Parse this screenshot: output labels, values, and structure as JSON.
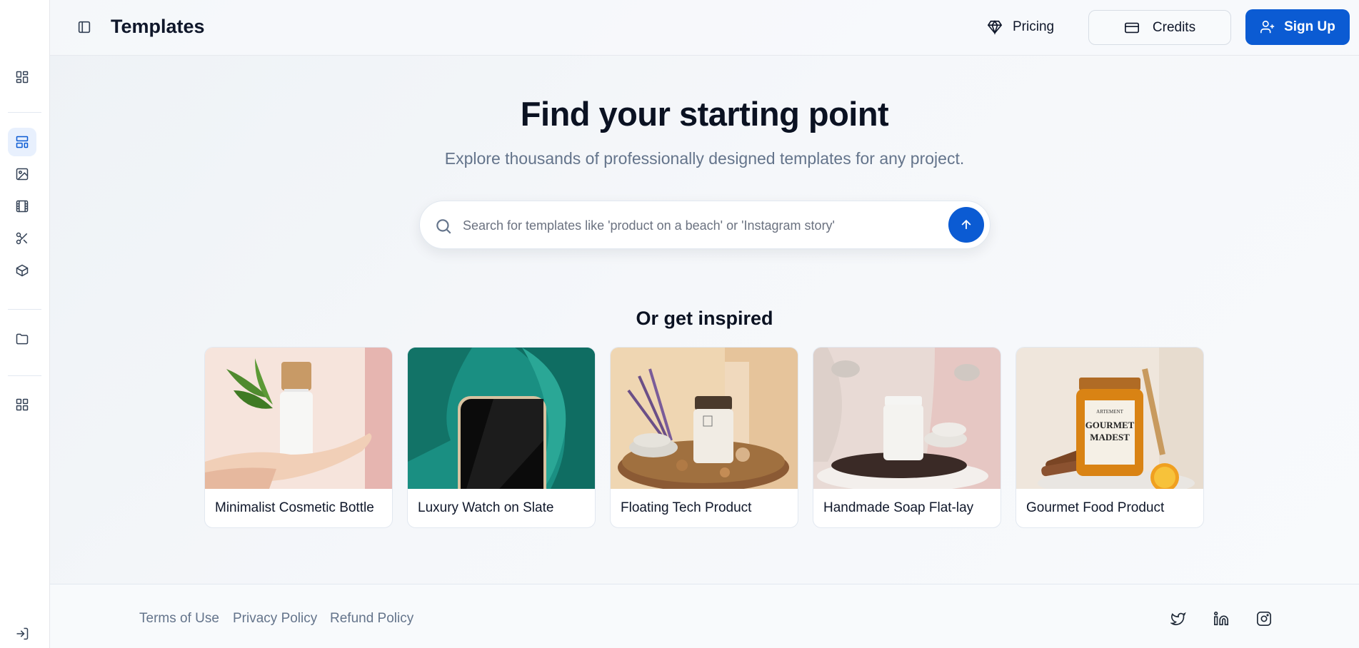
{
  "header": {
    "title": "Templates",
    "pricing_label": "Pricing",
    "credits_label": "Credits",
    "signup_label": "Sign Up"
  },
  "sidebar": {
    "items": [
      {
        "icon": "dashboard-icon"
      },
      {
        "icon": "templates-icon",
        "active": true
      },
      {
        "icon": "image-icon"
      },
      {
        "icon": "film-icon"
      },
      {
        "icon": "scissors-icon"
      },
      {
        "icon": "box-icon"
      },
      {
        "icon": "folder-icon"
      },
      {
        "icon": "apps-icon"
      },
      {
        "icon": "login-icon"
      }
    ]
  },
  "hero": {
    "title": "Find your starting point",
    "subtitle": "Explore thousands of professionally designed templates for any project."
  },
  "search": {
    "placeholder": "Search for templates like 'product on a beach' or 'Instagram story'",
    "value": ""
  },
  "inspired": {
    "title": "Or get inspired",
    "cards": [
      {
        "label": "Minimalist Cosmetic Bottle"
      },
      {
        "label": "Luxury Watch on Slate"
      },
      {
        "label": "Floating Tech Product"
      },
      {
        "label": "Handmade Soap Flat-lay"
      },
      {
        "label": "Gourmet Food Product"
      }
    ],
    "jar_label": {
      "line1": "ARTEMENT",
      "line2": "GOURMET",
      "line3": "MADEST"
    }
  },
  "footer": {
    "links": [
      "Terms of Use",
      "Privacy Policy",
      "Refund Policy"
    ],
    "socials": [
      "twitter-icon",
      "linkedin-icon",
      "instagram-icon"
    ]
  },
  "colors": {
    "accent": "#0b5bd3",
    "active_bg": "#e8f0fd",
    "muted_text": "#64748b"
  }
}
